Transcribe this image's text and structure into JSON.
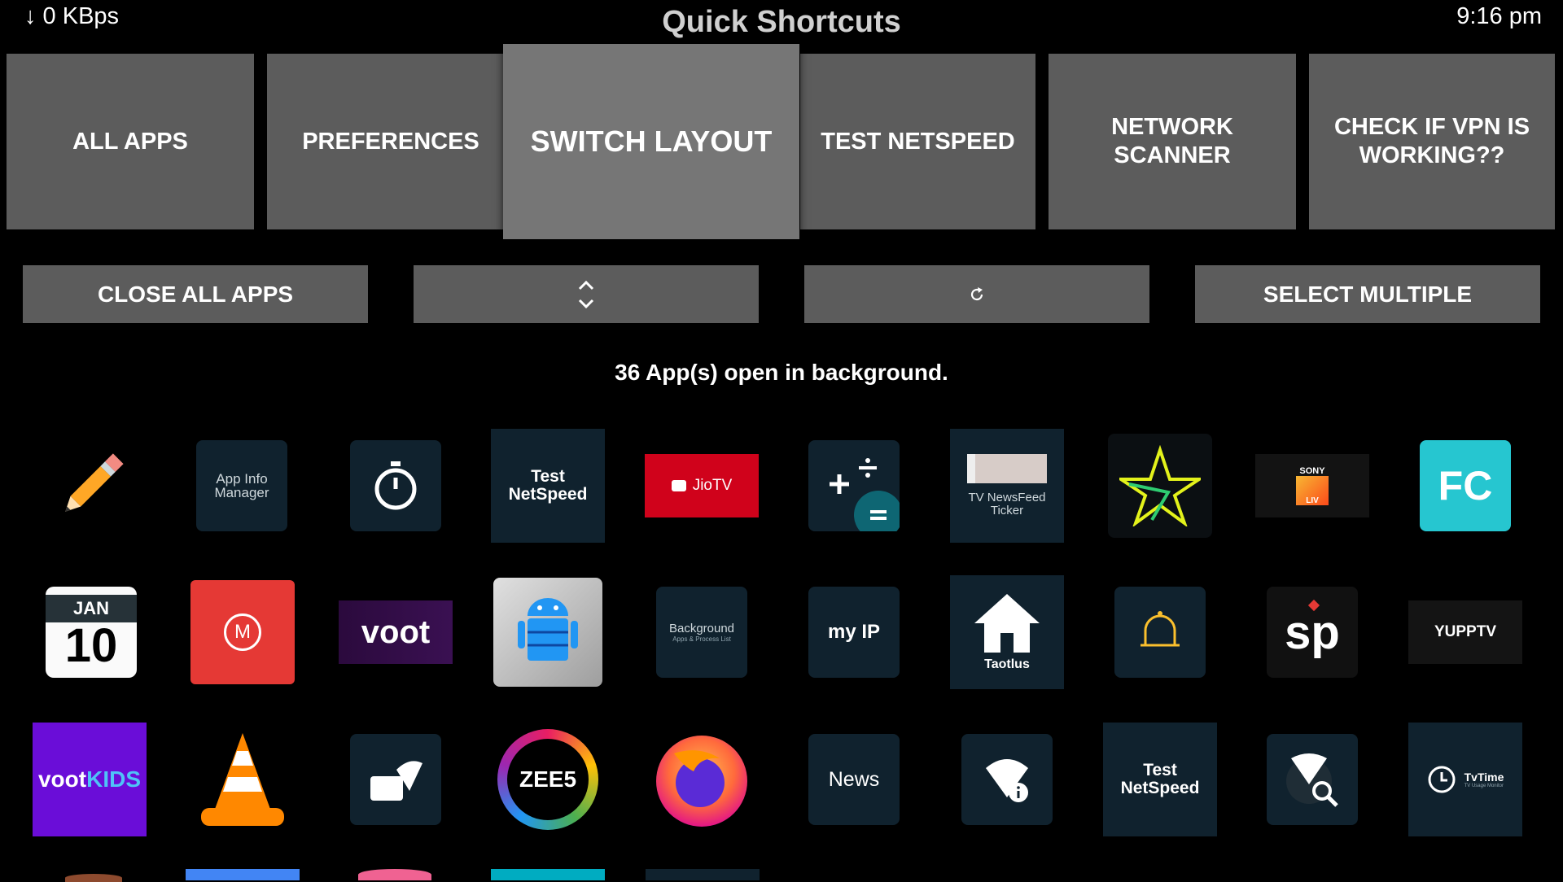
{
  "status": {
    "speed": "↓ 0 KBps",
    "time": "9:16 pm"
  },
  "header": {
    "title": "Quick Shortcuts"
  },
  "tiles": [
    {
      "label": "ALL APPS"
    },
    {
      "label": "PREFERENCES"
    },
    {
      "label": "SWITCH LAYOUT"
    },
    {
      "label": "TEST NETSPEED"
    },
    {
      "label": "NETWORK SCANNER"
    },
    {
      "label": "CHECK IF VPN IS WORKING??"
    }
  ],
  "actions": {
    "close_all": "CLOSE ALL APPS",
    "sort_icon": "up-down-chevrons-icon",
    "refresh_icon": "refresh-icon",
    "select_multiple": "SELECT MULTIPLE"
  },
  "info": "36 App(s) open in background.",
  "apps": {
    "row1": [
      {
        "icon": "pencil-icon"
      },
      {
        "icon": "app-info-manager-icon",
        "text": "App Info Manager"
      },
      {
        "icon": "stopwatch-icon"
      },
      {
        "icon": "test-netspeed-icon",
        "text_top": "Test",
        "text_bottom": "NetSpeed"
      },
      {
        "icon": "jiotv-icon",
        "text": "JioTV"
      },
      {
        "icon": "calculator-icon"
      },
      {
        "icon": "tv-newsfeed-ticker-icon",
        "text": "TV NewsFeed Ticker"
      },
      {
        "icon": "hotstar-star-icon"
      },
      {
        "icon": "sony-liv-icon",
        "text_top": "SONY",
        "text_bottom": "LIV"
      },
      {
        "icon": "fc-logo-icon",
        "text": "FC"
      }
    ],
    "row2": [
      {
        "icon": "calendar-icon",
        "month": "JAN",
        "day": "10"
      },
      {
        "icon": "mx-cast-icon",
        "text": "M"
      },
      {
        "icon": "voot-icon",
        "text": "voot"
      },
      {
        "icon": "android-robot-icon"
      },
      {
        "icon": "background-apps-icon",
        "text": "Background",
        "subtext": "Apps & Process List"
      },
      {
        "icon": "my-ip-icon",
        "text": "my IP"
      },
      {
        "icon": "taotlus-home-icon",
        "text": "Taotlus"
      },
      {
        "icon": "bell-icon"
      },
      {
        "icon": "sp-logo-icon",
        "text": "sp"
      },
      {
        "icon": "yupptv-icon",
        "text": "YUPPTV"
      }
    ],
    "row3": [
      {
        "icon": "voot-kids-icon",
        "text_a": "voot",
        "text_b": "KIDS"
      },
      {
        "icon": "vlc-cone-icon"
      },
      {
        "icon": "wifi-box-icon"
      },
      {
        "icon": "zee5-icon",
        "text": "ZEE5"
      },
      {
        "icon": "firefox-icon"
      },
      {
        "icon": "news-icon",
        "text": "News"
      },
      {
        "icon": "wifi-info-icon"
      },
      {
        "icon": "test-netspeed-icon",
        "text_top": "Test",
        "text_bottom": "NetSpeed"
      },
      {
        "icon": "wifi-search-icon"
      },
      {
        "icon": "tvtime-icon",
        "text": "TvTime",
        "subtext": "TV Usage Monitor"
      }
    ]
  }
}
